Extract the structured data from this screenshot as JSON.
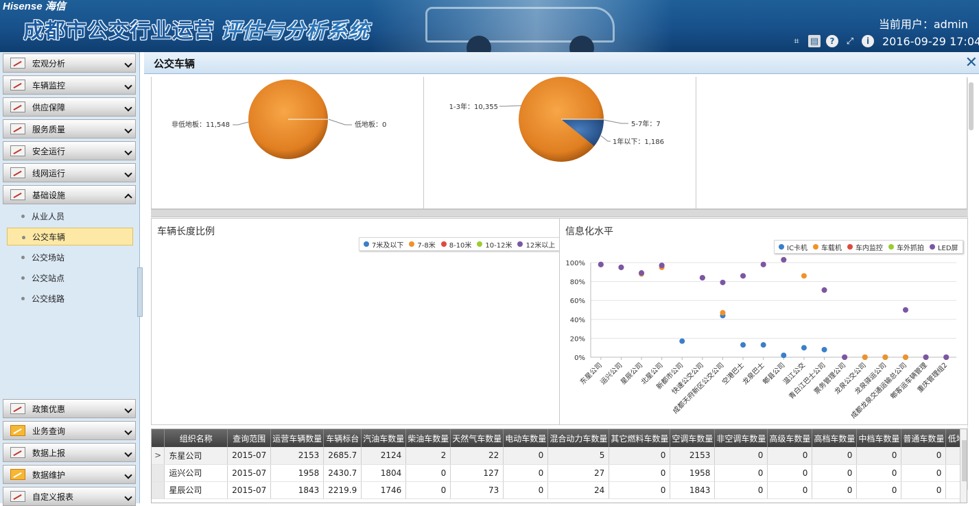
{
  "header": {
    "brand": "Hisense 海信",
    "title_a": "成都市公交行业运营",
    "title_b": " 评估与分析系统",
    "user": "当前用户：admin",
    "datetime": "2016-09-29 17:04"
  },
  "toolbar_icons": [
    "crop-icon",
    "keyboard-icon",
    "help-icon",
    "expand-icon",
    "info-icon"
  ],
  "sidebar": {
    "top_menus": [
      {
        "label": "宏观分析",
        "icon": "chart-line-icon"
      },
      {
        "label": "车辆监控",
        "icon": "camera-icon"
      },
      {
        "label": "供应保障",
        "icon": "supply-icon"
      },
      {
        "label": "服务质量",
        "icon": "edit-icon"
      },
      {
        "label": "安全运行",
        "icon": "edit-icon"
      },
      {
        "label": "线网运行",
        "icon": "calendar-icon"
      },
      {
        "label": "基础设施",
        "icon": "infra-icon"
      }
    ],
    "sub_items": [
      "从业人员",
      "公交车辆",
      "公交场站",
      "公交站点",
      "公交线路"
    ],
    "active_sub": "公交车辆",
    "bottom_menus": [
      {
        "label": "政策优惠",
        "icon": "policy-icon"
      },
      {
        "label": "业务查询",
        "icon": "chart-icon"
      },
      {
        "label": "数据上报",
        "icon": "edit-icon"
      },
      {
        "label": "数据维护",
        "icon": "chart-icon"
      },
      {
        "label": "自定义报表",
        "icon": "calendar-icon"
      }
    ]
  },
  "tab": {
    "title": "公交车辆"
  },
  "colors": {
    "orange": "#e8892f",
    "blue": "#2c5f9e",
    "ic": "#3a7fc9",
    "car": "#f0922b",
    "monitor": "#e04a3b",
    "snap": "#9acd32",
    "led": "#7b56a6"
  },
  "chart_data": [
    {
      "type": "pie",
      "title": "",
      "slices": [
        {
          "label": "非低地板",
          "value": 11548
        },
        {
          "label": "低地板",
          "value": 0
        }
      ],
      "labels_text": [
        "非低地板：11,548",
        "低地板：0"
      ]
    },
    {
      "type": "pie",
      "title": "",
      "slices": [
        {
          "label": "1-3年",
          "value": 10355
        },
        {
          "label": "1年以下",
          "value": 1186
        },
        {
          "label": "5-7年",
          "value": 7
        }
      ],
      "labels_text": [
        "1-3年：10,355",
        "1年以下：1,186",
        "5-7年：7"
      ]
    },
    {
      "type": "bar",
      "title": "车辆长度比例",
      "series": [
        {
          "name": "7米及以下",
          "values": []
        },
        {
          "name": "7-8米",
          "values": []
        },
        {
          "name": "8-10米",
          "values": []
        },
        {
          "name": "10-12米",
          "values": []
        },
        {
          "name": "12米以上",
          "values": []
        }
      ]
    },
    {
      "type": "scatter",
      "title": "信息化水平",
      "y_ticks": [
        "100%",
        "80%",
        "60%",
        "40%",
        "20%",
        "0%"
      ],
      "ylim": [
        0,
        100
      ],
      "categories": [
        "东星公司",
        "运兴公司",
        "星辰公司",
        "北星公司",
        "新都市公司",
        "快速公交公司",
        "成都天府新区公交公司",
        "空港巴士",
        "龙泉巴士",
        "郫县公司",
        "温江公交",
        "青白江巴士公司",
        "票务管理公司",
        "龙泉公交公司",
        "龙泉驿运公司",
        "成都龙泉交通运输总公司",
        "郫客运车辆管理",
        "重庆管理组2"
      ],
      "series": [
        {
          "name": "IC卡机",
          "values": [
            98,
            95,
            89,
            97,
            17,
            84,
            44,
            13,
            13,
            2,
            10,
            8,
            0,
            0,
            0,
            0,
            0,
            0
          ]
        },
        {
          "name": "车载机",
          "values": [
            98,
            95,
            88,
            95,
            null,
            84,
            47,
            86,
            98,
            103,
            86,
            71,
            0,
            0,
            0,
            0,
            0,
            0
          ]
        },
        {
          "name": "车内监控",
          "values": []
        },
        {
          "name": "车外抓拍",
          "values": []
        },
        {
          "name": "LED屏",
          "values": [
            98,
            95,
            89,
            97,
            null,
            84,
            79,
            86,
            98,
            103,
            null,
            71,
            0,
            null,
            null,
            50,
            0,
            0
          ]
        }
      ]
    }
  ],
  "grid": {
    "columns": [
      "组织名称",
      "查询范围",
      "运营车辆数量",
      "车辆标台",
      "汽油车数量",
      "柴油车数量",
      "天然气车数量",
      "电动车数量",
      "混合动力车数量",
      "其它燃料车数量",
      "空调车数量",
      "非空调车数量",
      "高级车数量",
      "高档车数量",
      "中档车数量",
      "普通车数量",
      "低地"
    ],
    "rows": [
      [
        "东星公司",
        "2015-07",
        "2153",
        "2685.7",
        "2124",
        "2",
        "22",
        "0",
        "5",
        "0",
        "2153",
        "0",
        "0",
        "0",
        "0",
        "0",
        ""
      ],
      [
        "运兴公司",
        "2015-07",
        "1958",
        "2430.7",
        "1804",
        "0",
        "127",
        "0",
        "27",
        "0",
        "1958",
        "0",
        "0",
        "0",
        "0",
        "0",
        ""
      ],
      [
        "星辰公司",
        "2015-07",
        "1843",
        "2219.9",
        "1746",
        "0",
        "73",
        "0",
        "24",
        "0",
        "1843",
        "0",
        "0",
        "0",
        "0",
        "0",
        ""
      ]
    ],
    "row_indicator": ">"
  }
}
